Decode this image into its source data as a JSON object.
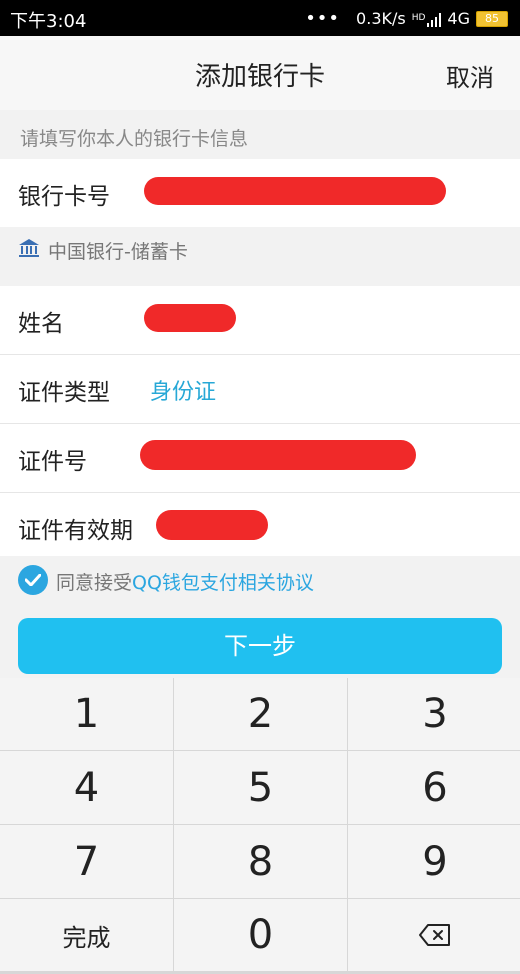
{
  "status": {
    "time": "下午3:04",
    "dots": "•••",
    "network_speed": "0.3K/s",
    "hd": "HD",
    "network_type": "4G",
    "battery": "85"
  },
  "header": {
    "title": "添加银行卡",
    "cancel": "取消"
  },
  "hint": "请填写你本人的银行卡信息",
  "bank_card": {
    "label": "银行卡号",
    "bank_name": "中国银行-储蓄卡"
  },
  "name_row": {
    "label": "姓名"
  },
  "id_type_row": {
    "label": "证件类型",
    "value": "身份证"
  },
  "id_number_row": {
    "label": "证件号"
  },
  "id_validity_row": {
    "label": "证件有效期"
  },
  "agreement": {
    "text": "同意接受",
    "link": "QQ钱包支付相关协议"
  },
  "next_button": "下一步",
  "keypad": {
    "keys": [
      "1",
      "2",
      "3",
      "4",
      "5",
      "6",
      "7",
      "8",
      "9",
      "完成",
      "0"
    ]
  },
  "colors": {
    "accent": "#20c0f0",
    "link": "#2ba6e0",
    "redaction": "#ef1d1d"
  }
}
